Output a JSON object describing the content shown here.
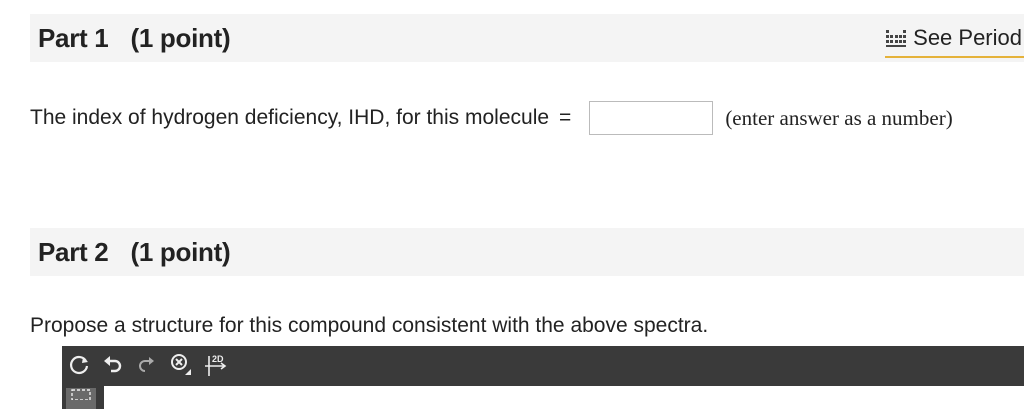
{
  "part1": {
    "title": "Part 1",
    "points": "(1 point)",
    "periodic_link": "See Period",
    "question": "The index of hydrogen deficiency, IHD, for this molecule",
    "equals": "=",
    "answer_value": "",
    "hint": "(enter answer as a number)"
  },
  "part2": {
    "title": "Part 2",
    "points": "(1 point)",
    "prompt": "Propose a structure for this compound consistent with the above spectra."
  },
  "editor": {
    "tools": [
      "reset-icon",
      "undo-icon",
      "redo-icon",
      "zoom-clear-icon",
      "clean-2d-icon"
    ],
    "clean_label": "2D"
  },
  "colors": {
    "header_bg": "#f4f4f4",
    "link_underline": "#e5b23a",
    "editor_bg": "#3a3a3a"
  }
}
